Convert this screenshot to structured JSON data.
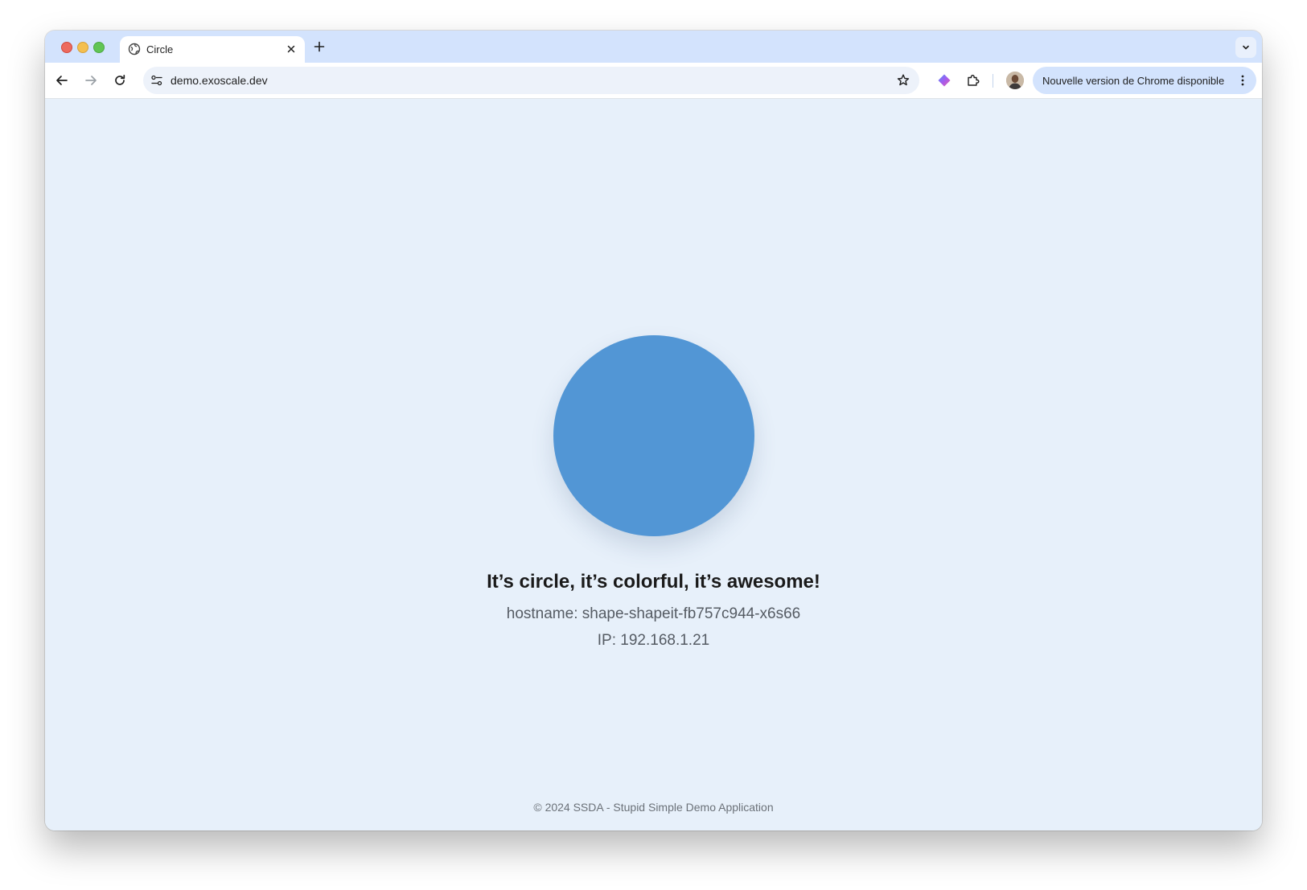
{
  "browser": {
    "tab": {
      "title": "Circle"
    },
    "address_bar": {
      "url": "demo.exoscale.dev"
    },
    "update_prompt": {
      "label": "Nouvelle version de Chrome disponible"
    }
  },
  "page": {
    "shape_color": "#5296d5",
    "headline": "It’s circle, it’s colorful, it’s awesome!",
    "hostname": "hostname: shape-shapeit-fb757c944-x6s66",
    "ip": "IP: 192.168.1.21",
    "footer": "© 2024 SSDA - Stupid Simple Demo Application"
  },
  "colors": {
    "page_background": "#e7f0fa",
    "tabstrip": "#d3e3fd",
    "accent": "#5296d5"
  },
  "icons": {
    "tab_favicon": "globe-icon",
    "tab_close": "close-icon",
    "new_tab": "plus-icon",
    "tab_search": "chevron-down-icon",
    "back": "arrow-left-icon",
    "forward": "arrow-right-icon",
    "reload": "reload-icon",
    "site_info": "tune-icon",
    "bookmark": "star-icon",
    "extension_1": "gem-icon",
    "extensions": "puzzle-icon",
    "profile": "avatar",
    "menu": "kebab-icon"
  }
}
